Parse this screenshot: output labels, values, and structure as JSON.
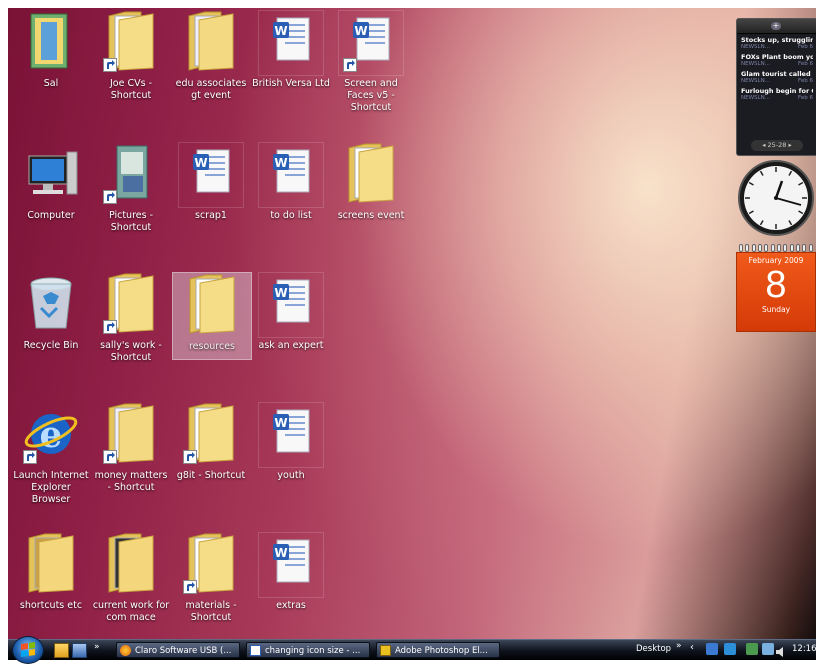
{
  "desktop": {
    "icons": [
      {
        "name": "sal-icon",
        "label": "Sal",
        "type": "binder"
      },
      {
        "name": "joe-cvs-shortcut-icon",
        "label": "Joe CVs - Shortcut",
        "type": "folder-shortcut"
      },
      {
        "name": "edu-associates-gt-event-icon",
        "label": "edu associates gt event",
        "type": "folder-doc"
      },
      {
        "name": "british-versa-ltd-icon",
        "label": "British Versa Ltd",
        "type": "word"
      },
      {
        "name": "screen-and-faces-shortcut-icon",
        "label": "Screen and Faces v5 - Shortcut",
        "type": "word-shortcut"
      },
      {
        "name": "computer-icon",
        "label": "Computer",
        "type": "computer"
      },
      {
        "name": "pictures-shortcut-icon",
        "label": "Pictures - Shortcut",
        "type": "pictures-shortcut"
      },
      {
        "name": "scrap1-icon",
        "label": "scrap1",
        "type": "word"
      },
      {
        "name": "to-do-list-icon",
        "label": "to do list",
        "type": "word"
      },
      {
        "name": "screens-event-icon",
        "label": "screens event",
        "type": "folder"
      },
      {
        "name": "recycle-bin-icon",
        "label": "Recycle Bin",
        "type": "recycle"
      },
      {
        "name": "sallys-work-shortcut-icon",
        "label": "sally's work - Shortcut",
        "type": "folder-shortcut"
      },
      {
        "name": "resources-icon",
        "label": "resources",
        "type": "folder",
        "selected": true
      },
      {
        "name": "ask-an-expert-icon",
        "label": "ask an expert",
        "type": "word"
      },
      {
        "name": "launch-ie-browser-icon",
        "label": "Launch Internet Explorer Browser",
        "type": "ie"
      },
      {
        "name": "money-matters-shortcut-icon",
        "label": "money matters - Shortcut",
        "type": "folder-doc-shortcut"
      },
      {
        "name": "g8it-shortcut-icon",
        "label": "g8it - Shortcut",
        "type": "folder-shortcut"
      },
      {
        "name": "youth-icon",
        "label": "youth",
        "type": "word"
      },
      {
        "name": "shortcuts-etc-icon",
        "label": "shortcuts etc",
        "type": "folder-img"
      },
      {
        "name": "current-work-for-com-mace-icon",
        "label": "current work for com mace",
        "type": "folder-dark"
      },
      {
        "name": "materials-shortcut-icon",
        "label": "materials - Shortcut",
        "type": "folder-shortcut"
      },
      {
        "name": "extras-icon",
        "label": "extras",
        "type": "word"
      }
    ]
  },
  "gadgets": {
    "feed": {
      "items": [
        {
          "headline": "Stocks up, struggling ...",
          "source": "NEWSLN...",
          "time": "Feb 6"
        },
        {
          "headline": "FOXs Plant boom you...",
          "source": "NEWSLN...",
          "time": "Feb 6"
        },
        {
          "headline": "Glam tourist called fl...",
          "source": "NEWSLN...",
          "time": "Feb 6"
        },
        {
          "headline": "Furlough begin for C...",
          "source": "NEWSLN...",
          "time": "Feb 6"
        }
      ],
      "nav_label": "25-28"
    },
    "clock": {
      "time": "12:16"
    },
    "calendar": {
      "month": "February 2009",
      "day": "8",
      "weekday": "Sunday"
    }
  },
  "taskbar": {
    "tasks": [
      {
        "label": "Claro Software USB (..."
      },
      {
        "label": "changing icon size - ..."
      },
      {
        "label": "Adobe Photoshop El..."
      }
    ],
    "desktop_label": "Desktop",
    "clock": "12:16"
  },
  "colors": {
    "accent_orange": "#e8501a",
    "folder_yellow": "#f2d57a",
    "word_blue": "#2a5fb5"
  }
}
